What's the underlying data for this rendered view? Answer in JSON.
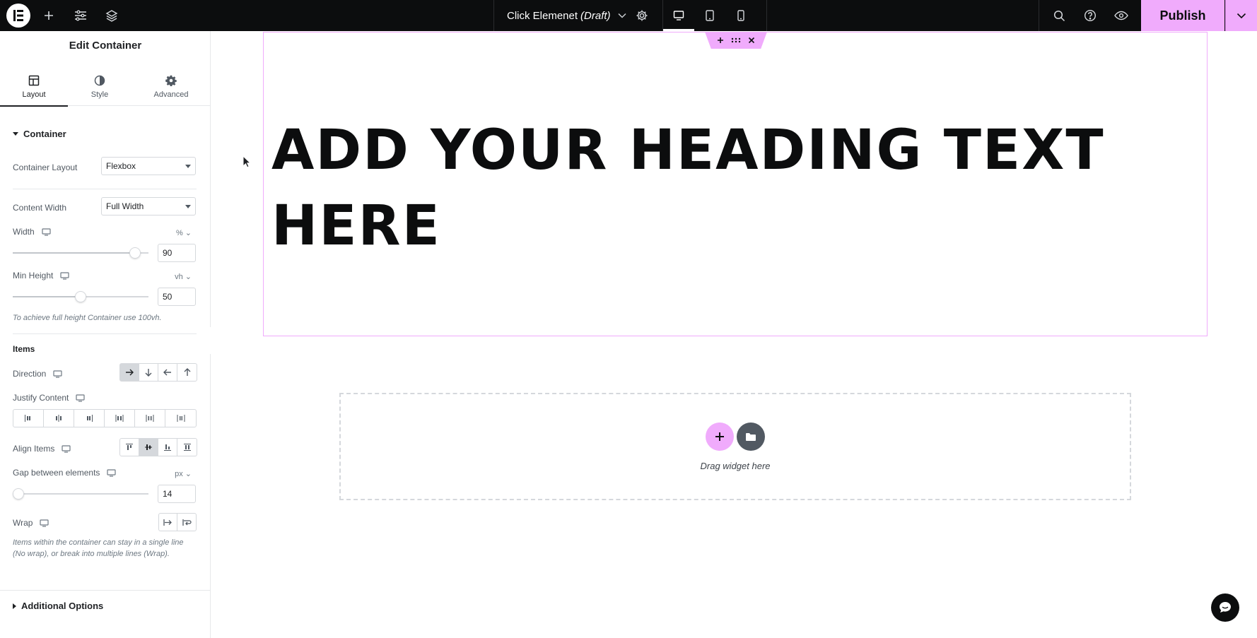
{
  "topbar": {
    "document_title": "Click Elemenet",
    "document_status": "(Draft)",
    "publish_label": "Publish"
  },
  "panel": {
    "title": "Edit Container",
    "tabs": [
      {
        "label": "Layout",
        "icon": "layout-icon",
        "active": true
      },
      {
        "label": "Style",
        "icon": "contrast-icon",
        "active": false
      },
      {
        "label": "Advanced",
        "icon": "gear-icon",
        "active": false
      }
    ],
    "container_section": "Container",
    "container_layout": {
      "label": "Container Layout",
      "value": "Flexbox"
    },
    "content_width": {
      "label": "Content Width",
      "value": "Full Width"
    },
    "width": {
      "label": "Width",
      "unit": "%",
      "value": "90",
      "slider_fraction": 0.9
    },
    "min_height": {
      "label": "Min Height",
      "unit": "vh",
      "value": "50",
      "slider_fraction": 0.5
    },
    "min_height_hint": "To achieve full height Container use 100vh.",
    "items_section": "Items",
    "direction": {
      "label": "Direction",
      "selected_index": 0
    },
    "justify_content": {
      "label": "Justify Content"
    },
    "align_items": {
      "label": "Align Items",
      "selected_index": 1
    },
    "gap": {
      "label": "Gap between elements",
      "unit": "px",
      "value": "14",
      "slider_fraction": 0.0
    },
    "wrap": {
      "label": "Wrap"
    },
    "wrap_hint": "Items within the container can stay in a single line (No wrap), or break into multiple lines (Wrap).",
    "additional_section": "Additional Options"
  },
  "canvas": {
    "heading": "ADD YOUR HEADING TEXT HERE",
    "dropzone_text": "Drag widget here"
  },
  "colors": {
    "accent": "#f0abfc",
    "topbar_bg": "#0c0d0e"
  }
}
